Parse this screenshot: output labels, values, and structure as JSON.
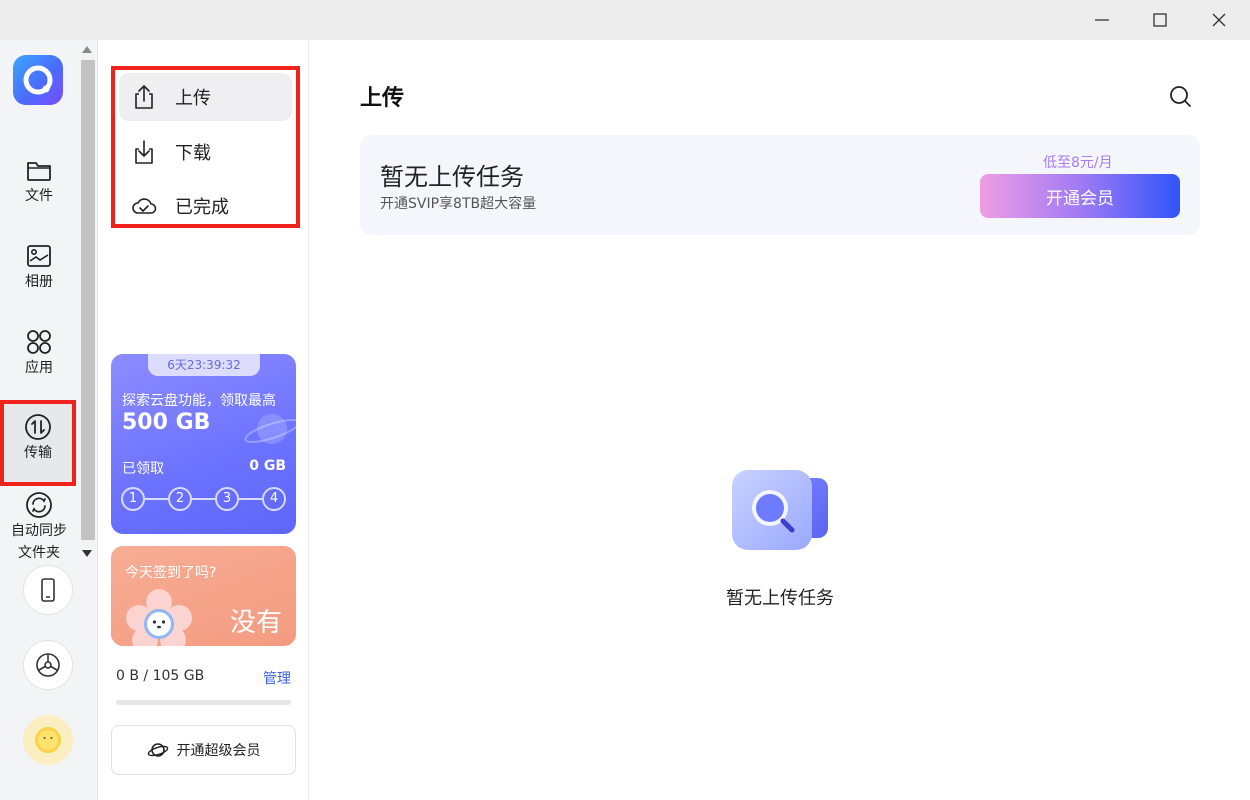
{
  "window": {
    "controls": [
      "minimize",
      "maximize",
      "close"
    ]
  },
  "rail": {
    "items": [
      {
        "label": "文件",
        "icon": "folder-icon"
      },
      {
        "label": "相册",
        "icon": "photo-album-icon"
      },
      {
        "label": "应用",
        "icon": "apps-icon"
      },
      {
        "label": "传输",
        "icon": "transfer-icon",
        "active": true
      },
      {
        "label": "自动同步\n文件夹",
        "line1": "自动同步",
        "line2": "文件夹",
        "icon": "sync-icon"
      }
    ],
    "buttons": [
      "phone-icon",
      "settings-icon"
    ],
    "avatar": "avatar-sun"
  },
  "transfer_menu": {
    "items": [
      {
        "label": "上传",
        "icon": "upload-icon",
        "selected": true
      },
      {
        "label": "下载",
        "icon": "download-icon"
      },
      {
        "label": "已完成",
        "icon": "cloud-done-icon"
      }
    ]
  },
  "promo": {
    "timer": "6天23:39:32",
    "line1": "探索云盘功能，领取最高",
    "amount": "500 GB",
    "claimed_label": "已领取",
    "claimed_value": "0 GB",
    "steps": [
      "1",
      "2",
      "3",
      "4"
    ]
  },
  "signin": {
    "question": "今天签到了吗?",
    "answer": "没有"
  },
  "storage": {
    "usage": "0 B / 105 GB",
    "manage": "管理",
    "used_fraction": 0
  },
  "svip_button": "开通超级会员",
  "main": {
    "title": "上传",
    "banner": {
      "heading": "暂无上传任务",
      "sub": "开通SVIP享8TB超大容量",
      "price": "低至8元/月",
      "button": "开通会员"
    },
    "empty_text": "暂无上传任务"
  },
  "colors": {
    "accent": "#4a6cff",
    "highlight_border": "#f0231c",
    "promo_purple": "#6b72ff",
    "signin_salmon": "#f39b80"
  }
}
